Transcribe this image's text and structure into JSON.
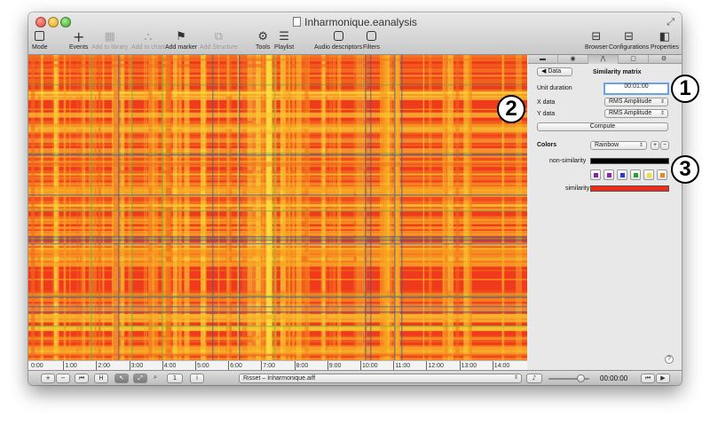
{
  "window": {
    "title": "Inharmonique.eanalysis"
  },
  "toolbar": {
    "mode": "Mode",
    "events": "Events",
    "add_to_library": "Add to library",
    "add_to_chart": "Add to chart",
    "add_marker": "Add marker",
    "add_structure": "Add Structure",
    "tools": "Tools",
    "playlist": "Playlist",
    "audio_descriptors": "Audio descriptors",
    "filters": "Filters",
    "browser": "Browser",
    "configurations": "Configurations",
    "properties": "Properties"
  },
  "ruler": {
    "ticks": [
      "0:00",
      "1:00",
      "2:00",
      "3:00",
      "4:00",
      "5:00",
      "6:00",
      "7:00",
      "8:00",
      "9:00",
      "10:00",
      "11:00",
      "12:00",
      "13:00",
      "14:00"
    ]
  },
  "panel": {
    "back_button": "◀ Data",
    "header": "Similarity matrix",
    "unit_duration_label": "Unit duration",
    "unit_duration_value": "00:01:00",
    "x_data_label": "X data",
    "x_data_value": "RMS Amplitude",
    "y_data_label": "Y data",
    "y_data_value": "RMS Amplitude",
    "compute_button": "Compute",
    "colors_label": "Colors",
    "colors_value": "Rainbow",
    "add_color": "+",
    "remove_color": "−",
    "non_similarity_label": "non-similarity",
    "non_similarity_color": "#000000",
    "similarity_label": "similarity",
    "similarity_color": "#ee2a1a",
    "palette": [
      "#7a2a9a",
      "#8a2ab0",
      "#2a3ad0",
      "#2aa02a",
      "#f0e030",
      "#e08a20"
    ],
    "help": "?"
  },
  "bottombar": {
    "add": "+",
    "remove": "−",
    "rewind": "⏮",
    "frame": "H",
    "pointer": "↖",
    "expand": "⤢",
    "zoom": "🔍",
    "page": "1",
    "info": "i",
    "file": "Risset – Inharmonique.aiff",
    "volume": "🔊",
    "time": "00:00:00",
    "prev": "⏮",
    "play": "▶"
  },
  "callouts": [
    "1",
    "2",
    "3"
  ]
}
